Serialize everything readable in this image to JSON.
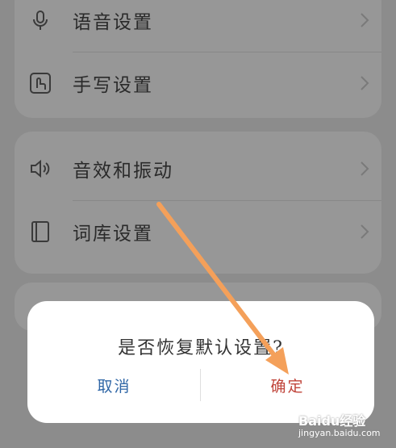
{
  "settings": {
    "group1": [
      {
        "label": "语音设置",
        "icon": "microphone-icon"
      },
      {
        "label": "手写设置",
        "icon": "handwriting-icon"
      }
    ],
    "group2": [
      {
        "label": "音效和振动",
        "icon": "speaker-icon"
      },
      {
        "label": "词库设置",
        "icon": "dictionary-icon"
      }
    ]
  },
  "dialog": {
    "title": "是否恢复默认设置?",
    "cancel_label": "取消",
    "confirm_label": "确定",
    "cancel_color": "#2f66a6",
    "confirm_color": "#c0443a"
  },
  "annotation": {
    "arrow_color": "#f4a05a"
  },
  "watermark": {
    "brand": "Baidu经验",
    "url": "jingyan.baidu.com"
  }
}
